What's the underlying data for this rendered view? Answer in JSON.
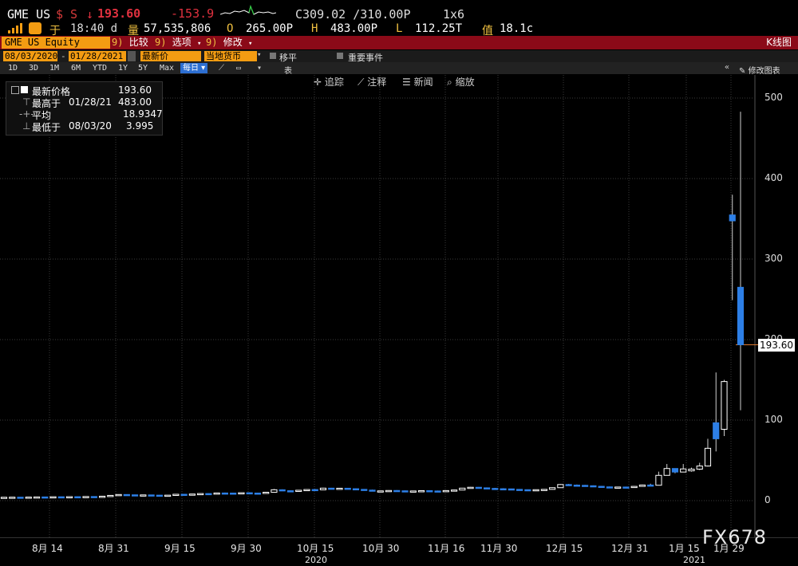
{
  "header": {
    "ticker": "GME US",
    "currency_marks": "$ S",
    "arrow": "↓",
    "last": "193.60",
    "change": "-153.9",
    "close_prev": "C309.02 /310.00P",
    "size": "1x6",
    "time_prefix": "于",
    "time": "18:40 d",
    "volume_label": "量",
    "volume": "57,535,806",
    "open_label": "O",
    "open": "265.00P",
    "high_label": "H",
    "high": "483.00P",
    "low_label": "L",
    "low": "112.25T",
    "value_label": "值",
    "value": "18.1c"
  },
  "toolbar": {
    "security": "GME US Equity",
    "compare_num": "9)",
    "compare": "比较",
    "options_num": "9)",
    "options": "选项",
    "edit_num": "9)",
    "edit": "修改",
    "title": "K线图",
    "date_from": "08/03/2020",
    "date_to": "01/28/2021",
    "price_field": "最新价",
    "currency_field": "当地货币",
    "move_label": "移平",
    "events_label": "重要事件",
    "periods": [
      "1D",
      "3D",
      "1M",
      "6M",
      "YTD",
      "1Y",
      "5Y",
      "Max"
    ],
    "frequency": "每日",
    "table_label": "表",
    "edit_chart": "修改图表",
    "tools": [
      "追踪",
      "注释",
      "新闻",
      "缩放"
    ]
  },
  "legend": {
    "rows": [
      {
        "label": "最新价格",
        "date": "",
        "value": "193.60"
      },
      {
        "label": "最高于",
        "date": "01/28/21",
        "value": "483.00"
      },
      {
        "label": "平均",
        "date": "",
        "value": "18.9347"
      },
      {
        "label": "最低于",
        "date": "08/03/20",
        "value": "3.995"
      }
    ]
  },
  "chart_data": {
    "type": "candlestick",
    "title": "",
    "ylim": [
      -5,
      505
    ],
    "yticks": [
      0,
      100,
      200,
      300,
      400,
      500
    ],
    "current_label": "193.60",
    "x_tick_labels": [
      "8月 14",
      "8月 31",
      "9月 15",
      "9月 30",
      "10月 15",
      "10月 30",
      "11月 16",
      "11月 30",
      "12月 15",
      "12月 31",
      "1月 15",
      "1月 29"
    ],
    "year_labels": [
      "2020",
      "2021"
    ],
    "candles": [
      {
        "o": 4.0,
        "h": 4.3,
        "l": 3.99,
        "c": 4.2
      },
      {
        "o": 4.2,
        "h": 4.4,
        "l": 4.0,
        "c": 4.3
      },
      {
        "o": 4.3,
        "h": 4.5,
        "l": 4.1,
        "c": 4.2
      },
      {
        "o": 4.2,
        "h": 4.5,
        "l": 4.1,
        "c": 4.4
      },
      {
        "o": 4.4,
        "h": 4.7,
        "l": 4.3,
        "c": 4.6
      },
      {
        "o": 4.6,
        "h": 4.8,
        "l": 4.4,
        "c": 4.5
      },
      {
        "o": 4.5,
        "h": 4.9,
        "l": 4.4,
        "c": 4.8
      },
      {
        "o": 4.8,
        "h": 5.0,
        "l": 4.6,
        "c": 4.7
      },
      {
        "o": 4.7,
        "h": 5.0,
        "l": 4.6,
        "c": 4.9
      },
      {
        "o": 4.9,
        "h": 5.1,
        "l": 4.7,
        "c": 4.8
      },
      {
        "o": 4.8,
        "h": 5.2,
        "l": 4.7,
        "c": 5.1
      },
      {
        "o": 5.1,
        "h": 5.3,
        "l": 4.9,
        "c": 5.0
      },
      {
        "o": 5.0,
        "h": 5.6,
        "l": 4.9,
        "c": 5.5
      },
      {
        "o": 5.5,
        "h": 6.6,
        "l": 5.4,
        "c": 6.5
      },
      {
        "o": 6.5,
        "h": 7.7,
        "l": 6.3,
        "c": 7.6
      },
      {
        "o": 7.6,
        "h": 7.9,
        "l": 7.0,
        "c": 7.2
      },
      {
        "o": 7.2,
        "h": 7.5,
        "l": 6.9,
        "c": 7.0
      },
      {
        "o": 7.0,
        "h": 7.4,
        "l": 6.8,
        "c": 7.1
      },
      {
        "o": 7.1,
        "h": 7.3,
        "l": 6.7,
        "c": 6.8
      },
      {
        "o": 6.8,
        "h": 7.0,
        "l": 6.4,
        "c": 6.5
      },
      {
        "o": 6.5,
        "h": 6.9,
        "l": 6.4,
        "c": 6.8
      },
      {
        "o": 6.8,
        "h": 8.0,
        "l": 6.7,
        "c": 7.9
      },
      {
        "o": 7.9,
        "h": 8.3,
        "l": 7.5,
        "c": 7.7
      },
      {
        "o": 7.7,
        "h": 8.3,
        "l": 7.6,
        "c": 8.2
      },
      {
        "o": 8.2,
        "h": 9.0,
        "l": 8.1,
        "c": 8.8
      },
      {
        "o": 8.8,
        "h": 9.1,
        "l": 8.4,
        "c": 8.6
      },
      {
        "o": 8.6,
        "h": 9.6,
        "l": 8.5,
        "c": 9.5
      },
      {
        "o": 9.5,
        "h": 10.0,
        "l": 9.2,
        "c": 9.4
      },
      {
        "o": 9.4,
        "h": 9.7,
        "l": 9.0,
        "c": 9.1
      },
      {
        "o": 9.1,
        "h": 9.9,
        "l": 9.0,
        "c": 9.8
      },
      {
        "o": 9.8,
        "h": 10.2,
        "l": 9.3,
        "c": 9.4
      },
      {
        "o": 9.4,
        "h": 9.7,
        "l": 9.1,
        "c": 9.3
      },
      {
        "o": 9.3,
        "h": 10.5,
        "l": 9.2,
        "c": 10.4
      },
      {
        "o": 10.4,
        "h": 14.5,
        "l": 10.2,
        "c": 13.5
      },
      {
        "o": 13.5,
        "h": 14.0,
        "l": 12.0,
        "c": 12.3
      },
      {
        "o": 12.3,
        "h": 12.8,
        "l": 11.5,
        "c": 11.9
      },
      {
        "o": 11.9,
        "h": 13.0,
        "l": 11.7,
        "c": 12.9
      },
      {
        "o": 12.9,
        "h": 14.0,
        "l": 12.5,
        "c": 13.8
      },
      {
        "o": 13.8,
        "h": 14.5,
        "l": 13.2,
        "c": 13.4
      },
      {
        "o": 13.4,
        "h": 16.0,
        "l": 13.3,
        "c": 15.5
      },
      {
        "o": 15.5,
        "h": 15.9,
        "l": 14.8,
        "c": 15.0
      },
      {
        "o": 15.0,
        "h": 15.6,
        "l": 14.5,
        "c": 15.4
      },
      {
        "o": 15.4,
        "h": 15.7,
        "l": 14.6,
        "c": 14.8
      },
      {
        "o": 14.8,
        "h": 15.2,
        "l": 13.8,
        "c": 14.0
      },
      {
        "o": 14.0,
        "h": 14.3,
        "l": 12.9,
        "c": 13.1
      },
      {
        "o": 13.1,
        "h": 13.6,
        "l": 11.5,
        "c": 11.8
      },
      {
        "o": 11.8,
        "h": 12.4,
        "l": 11.3,
        "c": 12.1
      },
      {
        "o": 12.1,
        "h": 12.9,
        "l": 11.8,
        "c": 12.6
      },
      {
        "o": 12.6,
        "h": 13.0,
        "l": 11.9,
        "c": 12.2
      },
      {
        "o": 12.2,
        "h": 12.6,
        "l": 11.6,
        "c": 11.8
      },
      {
        "o": 11.8,
        "h": 12.3,
        "l": 11.4,
        "c": 12.0
      },
      {
        "o": 12.0,
        "h": 12.6,
        "l": 11.7,
        "c": 12.4
      },
      {
        "o": 12.4,
        "h": 12.8,
        "l": 11.8,
        "c": 12.0
      },
      {
        "o": 12.0,
        "h": 12.5,
        "l": 11.6,
        "c": 11.8
      },
      {
        "o": 11.8,
        "h": 12.6,
        "l": 11.5,
        "c": 12.5
      },
      {
        "o": 12.5,
        "h": 13.5,
        "l": 12.3,
        "c": 13.2
      },
      {
        "o": 13.2,
        "h": 15.8,
        "l": 13.0,
        "c": 15.5
      },
      {
        "o": 15.5,
        "h": 17.0,
        "l": 15.2,
        "c": 16.6
      },
      {
        "o": 16.6,
        "h": 16.9,
        "l": 15.6,
        "c": 15.9
      },
      {
        "o": 15.9,
        "h": 16.4,
        "l": 15.0,
        "c": 15.2
      },
      {
        "o": 15.2,
        "h": 15.8,
        "l": 14.6,
        "c": 14.8
      },
      {
        "o": 14.8,
        "h": 15.4,
        "l": 14.3,
        "c": 14.6
      },
      {
        "o": 14.6,
        "h": 14.9,
        "l": 13.8,
        "c": 14.0
      },
      {
        "o": 14.0,
        "h": 14.4,
        "l": 13.3,
        "c": 13.6
      },
      {
        "o": 13.6,
        "h": 13.9,
        "l": 12.8,
        "c": 13.0
      },
      {
        "o": 13.0,
        "h": 13.8,
        "l": 12.7,
        "c": 13.6
      },
      {
        "o": 13.6,
        "h": 14.2,
        "l": 13.3,
        "c": 14.0
      },
      {
        "o": 14.0,
        "h": 16.5,
        "l": 13.8,
        "c": 16.1
      },
      {
        "o": 16.1,
        "h": 20.5,
        "l": 15.9,
        "c": 20.0
      },
      {
        "o": 20.0,
        "h": 20.7,
        "l": 18.9,
        "c": 19.3
      },
      {
        "o": 19.3,
        "h": 20.0,
        "l": 18.6,
        "c": 19.0
      },
      {
        "o": 19.0,
        "h": 19.5,
        "l": 18.2,
        "c": 18.5
      },
      {
        "o": 18.5,
        "h": 18.9,
        "l": 17.6,
        "c": 17.8
      },
      {
        "o": 17.8,
        "h": 18.2,
        "l": 16.8,
        "c": 17.1
      },
      {
        "o": 17.1,
        "h": 17.5,
        "l": 16.0,
        "c": 16.3
      },
      {
        "o": 16.3,
        "h": 17.2,
        "l": 16.0,
        "c": 16.9
      },
      {
        "o": 16.9,
        "h": 17.4,
        "l": 16.2,
        "c": 16.5
      },
      {
        "o": 16.5,
        "h": 18.1,
        "l": 16.3,
        "c": 17.7
      },
      {
        "o": 17.7,
        "h": 19.9,
        "l": 17.5,
        "c": 19.4
      },
      {
        "o": 19.4,
        "h": 21.0,
        "l": 18.7,
        "c": 19.1
      },
      {
        "o": 19.1,
        "h": 36.0,
        "l": 19.0,
        "c": 31.4
      },
      {
        "o": 31.4,
        "h": 45.5,
        "l": 33.0,
        "c": 39.9
      },
      {
        "o": 39.9,
        "h": 40.0,
        "l": 34.0,
        "c": 35.5
      },
      {
        "o": 35.5,
        "h": 45.5,
        "l": 36.0,
        "c": 39.4
      },
      {
        "o": 37.0,
        "h": 41.0,
        "l": 36.0,
        "c": 39.1
      },
      {
        "o": 39.1,
        "h": 47.0,
        "l": 38.0,
        "c": 43.0
      },
      {
        "o": 43.0,
        "h": 76.8,
        "l": 42.3,
        "c": 65.0
      },
      {
        "o": 96.7,
        "h": 159.2,
        "l": 61.1,
        "c": 76.8
      },
      {
        "o": 88.6,
        "h": 150.0,
        "l": 80.2,
        "c": 147.9
      },
      {
        "o": 354.8,
        "h": 380.0,
        "l": 249.0,
        "c": 347.5
      },
      {
        "o": 265.0,
        "h": 483.0,
        "l": 112.25,
        "c": 193.6
      }
    ]
  }
}
